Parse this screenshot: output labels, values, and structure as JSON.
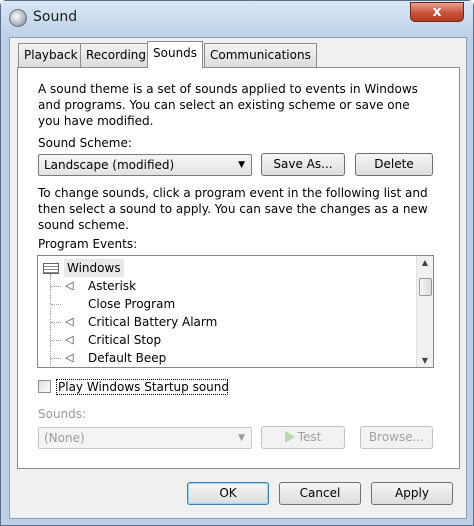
{
  "window": {
    "title": "Sound",
    "close_glyph": "x"
  },
  "tabs": [
    {
      "label": "Playback"
    },
    {
      "label": "Recording"
    },
    {
      "label": "Sounds"
    },
    {
      "label": "Communications"
    }
  ],
  "intro_text": "A sound theme is a set of sounds applied to events in Windows and programs.  You can select an existing scheme or save one you have modified.",
  "scheme": {
    "label": "Sound Scheme:",
    "selected": "Landscape (modified)",
    "save_as_label": "Save As...",
    "delete_label": "Delete"
  },
  "change_text": "To change sounds, click a program event in the following list and then select a sound to apply.  You can save the changes as a new sound scheme.",
  "events": {
    "label": "Program Events:",
    "group": "Windows",
    "items": [
      {
        "label": "Asterisk",
        "has_sound": true
      },
      {
        "label": "Close Program",
        "has_sound": false
      },
      {
        "label": "Critical Battery Alarm",
        "has_sound": true
      },
      {
        "label": "Critical Stop",
        "has_sound": true
      },
      {
        "label": "Default Beep",
        "has_sound": true
      }
    ]
  },
  "startup": {
    "label": "Play Windows Startup sound",
    "checked": false
  },
  "sounds": {
    "label": "Sounds:",
    "selected": "(None)",
    "test_label": "Test",
    "browse_label": "Browse..."
  },
  "footer": {
    "ok_label": "OK",
    "cancel_label": "Cancel",
    "apply_label": "Apply"
  },
  "icons": {
    "speaker": "speaker-icon",
    "group": "windows-group-icon"
  }
}
